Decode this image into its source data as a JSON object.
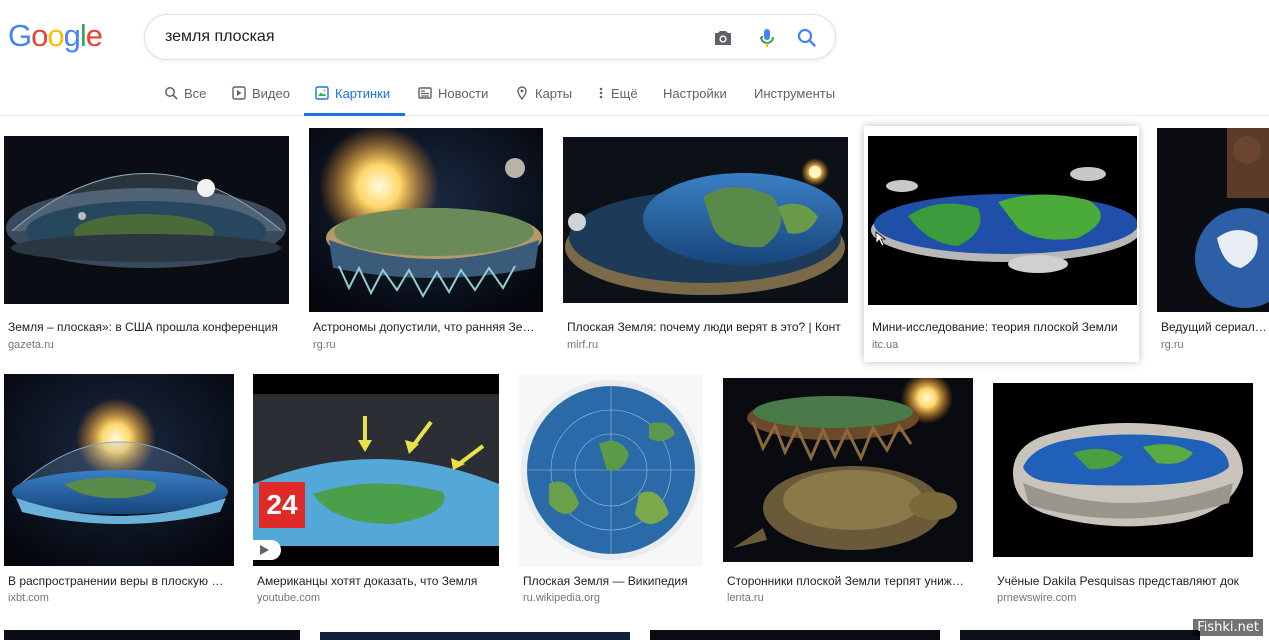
{
  "logo": {
    "letters": [
      "G",
      "o",
      "o",
      "g",
      "l",
      "e"
    ],
    "colors": [
      "#4285f4",
      "#ea4335",
      "#fbbc05",
      "#4285f4",
      "#34a853",
      "#ea4335"
    ]
  },
  "search": {
    "query": "земля плоская"
  },
  "tabs": [
    {
      "label": "Все",
      "icon": "search-icon"
    },
    {
      "label": "Видео",
      "icon": "play-icon"
    },
    {
      "label": "Картинки",
      "icon": "image-icon",
      "active": true
    },
    {
      "label": "Новости",
      "icon": "news-icon"
    },
    {
      "label": "Карты",
      "icon": "map-pin-icon"
    },
    {
      "label": "Ещё",
      "icon": "more-dots-icon"
    },
    {
      "label": "Настройки"
    },
    {
      "label": "Инструменты"
    }
  ],
  "results_row1": [
    {
      "caption": "Земля – плоская»: в США прошла конференция",
      "source": "gazeta.ru"
    },
    {
      "caption": "Астрономы допустили, что ранняя Земля",
      "source": "rg.ru"
    },
    {
      "caption": "Плоская Земля: почему люди верят в это? | Конт",
      "source": "mirf.ru"
    },
    {
      "caption": "Мини-исследование: теория плоской Земли",
      "source": "itc.ua"
    },
    {
      "caption": "Ведущий сериала \"",
      "source": "rg.ru"
    }
  ],
  "results_row2": [
    {
      "caption": "В распространении веры в плоскую Землю",
      "source": "ixbt.com"
    },
    {
      "caption": "Американцы хотят доказать, что Земля",
      "source": "youtube.com",
      "badge": "24"
    },
    {
      "caption": "Плоская Земля — Википедия",
      "source": "ru.wikipedia.org"
    },
    {
      "caption": "Сторонники плоской Земли терпят унижение",
      "source": "lenta.ru"
    },
    {
      "caption": "Учёные Dakila Pesquisas представляют док",
      "source": "prnewswire.com"
    }
  ],
  "watermark": "Fishki.net"
}
